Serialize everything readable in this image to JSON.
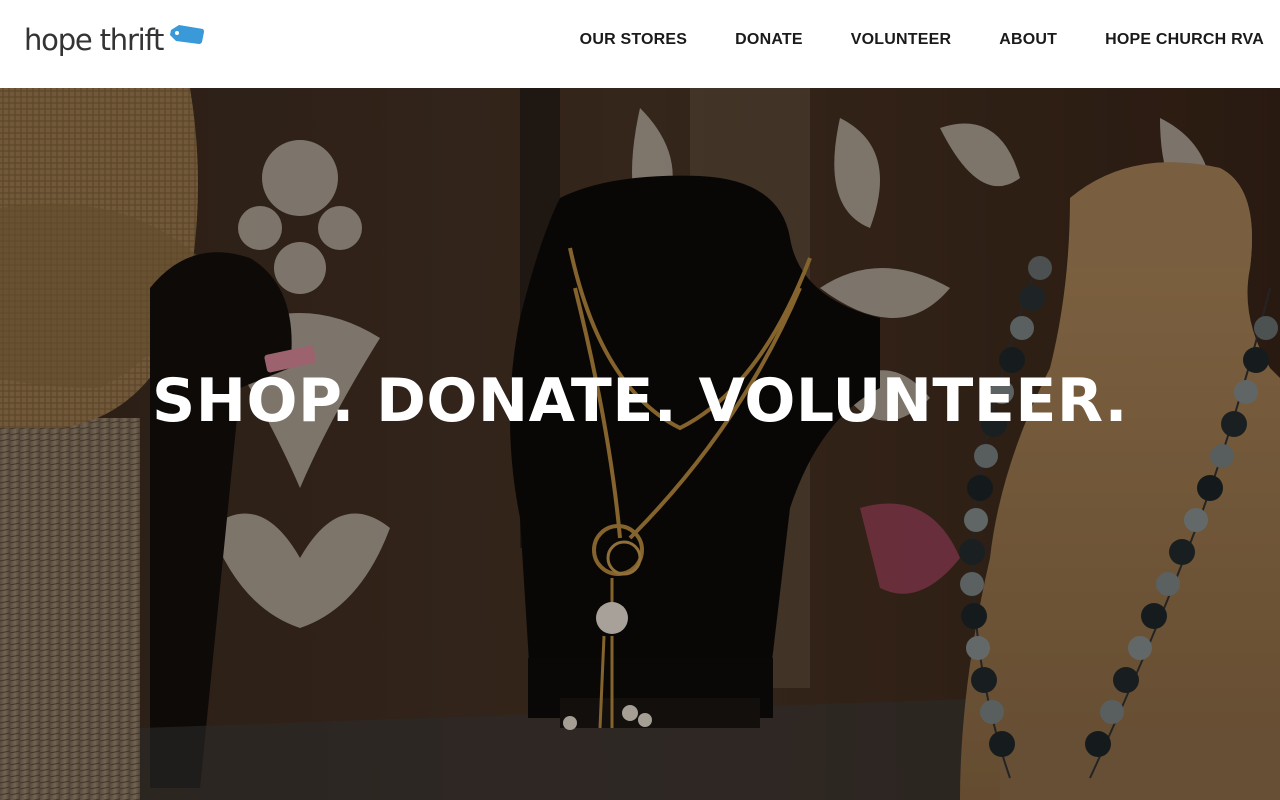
{
  "logo": {
    "text": "hope thrift",
    "icon": "price-tag-icon",
    "tag_color": "#3a9ad9"
  },
  "nav": {
    "items": [
      {
        "label": "OUR STORES"
      },
      {
        "label": "DONATE"
      },
      {
        "label": "VOLUNTEER"
      },
      {
        "label": "ABOUT"
      },
      {
        "label": "HOPE CHURCH RVA"
      }
    ]
  },
  "hero": {
    "headline": "SHOP. DONATE. VOLUNTEER.",
    "headline_color": "#ffffff"
  }
}
